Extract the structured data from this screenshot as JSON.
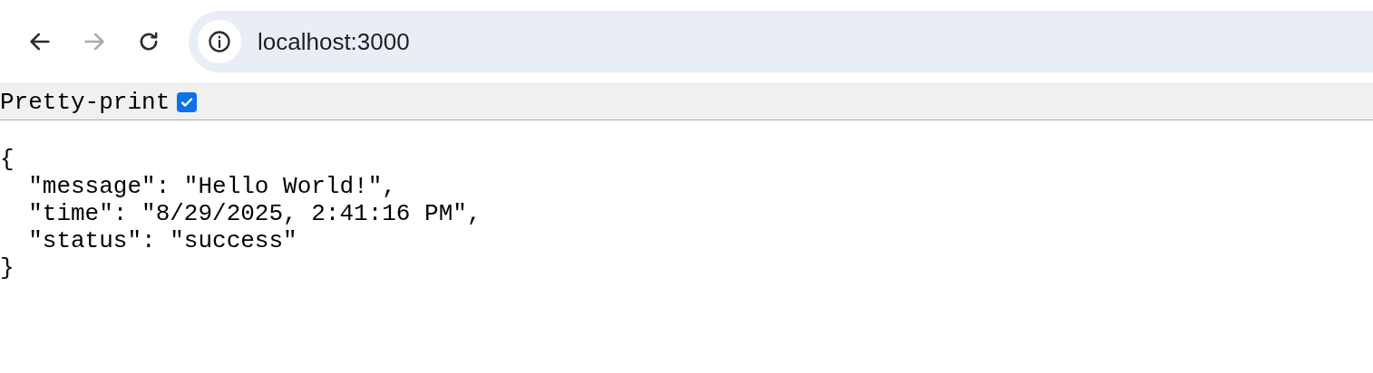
{
  "toolbar": {
    "nav_buttons": [
      {
        "kind": "back",
        "disabled": false
      },
      {
        "kind": "forward",
        "disabled": true
      },
      {
        "kind": "reload",
        "disabled": false
      }
    ],
    "address": "localhost:3000"
  },
  "pretty_print": {
    "label": "Pretty-print",
    "checked": true
  },
  "json_lines": [
    "{",
    "  \"message\": \"Hello World!\",",
    "  \"time\": \"8/29/2025, 2:41:16 PM\",",
    "  \"status\": \"success\"",
    "}"
  ]
}
